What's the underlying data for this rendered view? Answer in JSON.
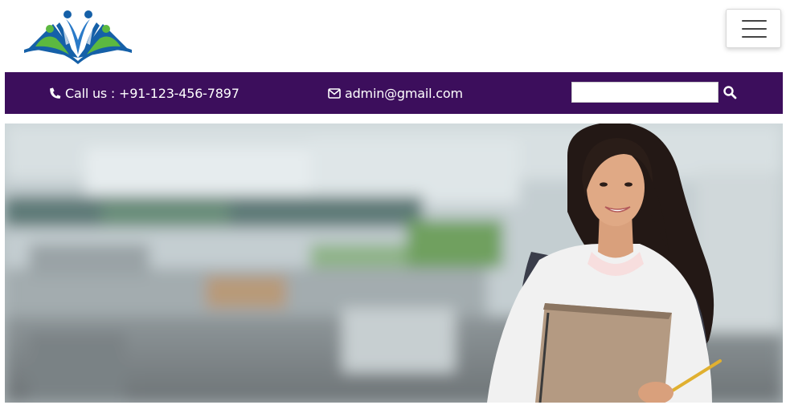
{
  "header": {
    "logo_name": "education-logo",
    "menu_icon": "hamburger-menu-icon"
  },
  "topbar": {
    "phone_icon": "phone-icon",
    "phone_text": "Call us : +91-123-456-7897",
    "email_icon": "envelope-icon",
    "email_text": "admin@gmail.com",
    "search": {
      "value": "",
      "placeholder": ""
    },
    "search_icon": "search-icon",
    "background_color": "#3c0e5c"
  },
  "hero": {
    "image_description_icon": "student-hero-image"
  }
}
